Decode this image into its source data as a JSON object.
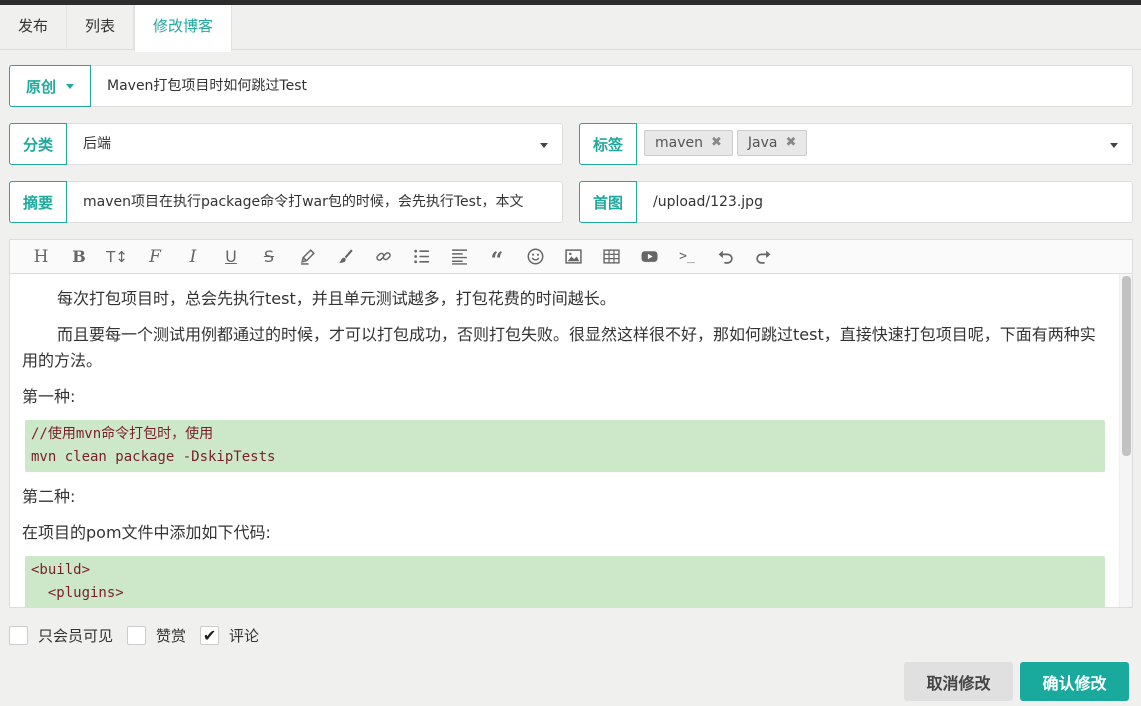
{
  "tabs": [
    {
      "label": "发布"
    },
    {
      "label": "列表"
    },
    {
      "label": "修改博客"
    }
  ],
  "type_label": "原创",
  "title_value": "Maven打包项目时如何跳过Test",
  "category": {
    "label": "分类",
    "value": "后端"
  },
  "tags": {
    "label": "标签",
    "items": [
      "maven",
      "Java"
    ]
  },
  "summary": {
    "label": "摘要",
    "value": "maven项目在执行package命令打war包的时候，会先执行Test，本文"
  },
  "cover": {
    "label": "首图",
    "value": "/upload/123.jpg"
  },
  "toolbar_icons": [
    "heading-icon",
    "bold-icon",
    "text-size-icon",
    "font-icon",
    "italic-icon",
    "underline-icon",
    "strikethrough-icon",
    "highlight-icon",
    "brush-icon",
    "link-icon",
    "list-icon",
    "align-icon",
    "quote-icon",
    "emoji-icon",
    "image-icon",
    "table-icon",
    "video-icon",
    "code-icon",
    "undo-icon",
    "redo-icon"
  ],
  "content": {
    "p1": "每次打包项目时，总会先执行test，并且单元测试越多，打包花费的时间越长。",
    "p2": "而且要每一个测试用例都通过的时候，才可以打包成功，否则打包失败。很显然这样很不好，那如何跳过test，直接快速打包项目呢，下面有两种实用的方法。",
    "h1": "第一种:",
    "code1_line1": "//使用mvn命令打包时，使用",
    "code1_line2": "mvn clean package -DskipTests",
    "h2": "第二种:",
    "p3": "在项目的pom文件中添加如下代码:",
    "code2_line1": "<build>",
    "code2_line2": "  <plugins>"
  },
  "options": [
    {
      "label": "只会员可见",
      "checked": false
    },
    {
      "label": "赞赏",
      "checked": false
    },
    {
      "label": "评论",
      "checked": true
    }
  ],
  "buttons": {
    "cancel": "取消修改",
    "confirm": "确认修改"
  },
  "colors": {
    "accent": "#1aaa9d",
    "code_bg": "#cde8c9",
    "code_text": "#7a1e2d"
  }
}
